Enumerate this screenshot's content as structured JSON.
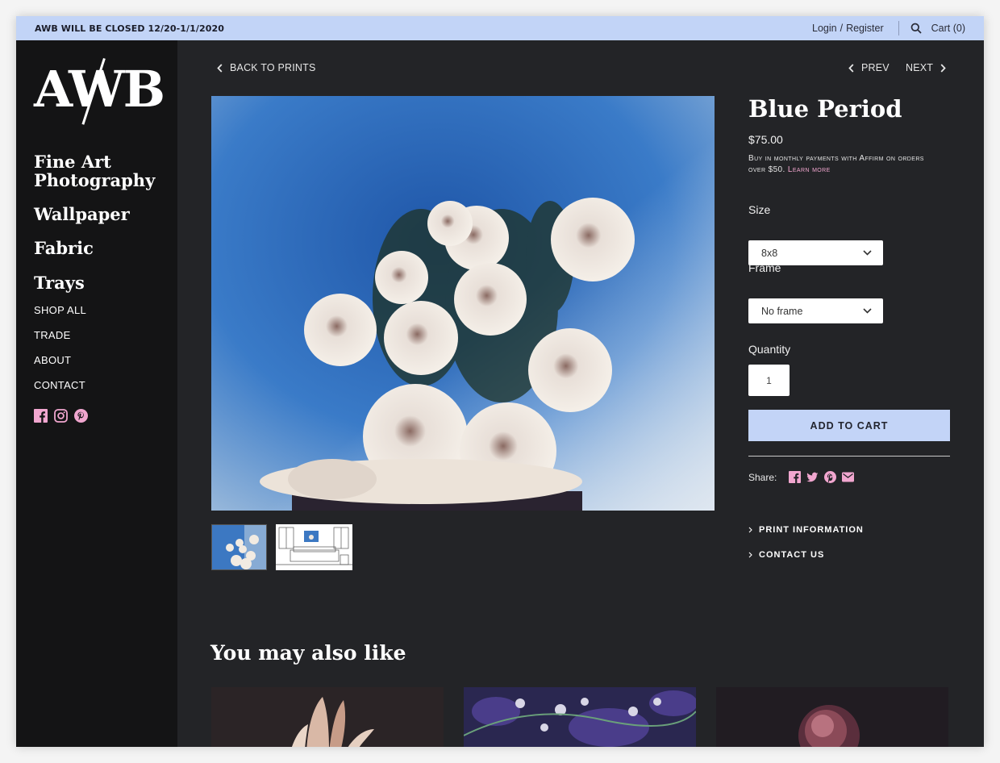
{
  "announcement": "AWB WILL BE CLOSED 12/20-1/1/2020",
  "topbar": {
    "login": "Login",
    "slash": "/",
    "register": "Register",
    "cart": "Cart (0)"
  },
  "logo": "AWB",
  "sidebar": {
    "big_items": [
      {
        "label": "Fine Art Photography"
      },
      {
        "label": "Wallpaper"
      },
      {
        "label": "Fabric"
      },
      {
        "label": "Trays"
      }
    ],
    "small_items": [
      {
        "label": "SHOP ALL"
      },
      {
        "label": "TRADE"
      },
      {
        "label": "ABOUT"
      },
      {
        "label": "CONTACT"
      }
    ],
    "socials": [
      "facebook-icon",
      "instagram-icon",
      "pinterest-icon"
    ]
  },
  "nav": {
    "back": "BACK TO PRINTS",
    "prev": "PREV",
    "next": "NEXT"
  },
  "product": {
    "title": "Blue Period",
    "price": "$75.00",
    "affirm_text": "Buy in monthly payments with Affirm on orders over $50.",
    "affirm_link": "Learn more",
    "size_label": "Size",
    "size_value": "8x8",
    "frame_label": "Frame",
    "frame_value": "No frame",
    "quantity_label": "Quantity",
    "quantity_value": "1",
    "add_to_cart": "ADD TO CART",
    "share_label": "Share:",
    "share_icons": [
      "facebook-icon",
      "twitter-icon",
      "pinterest-icon",
      "email-icon"
    ],
    "accordion": [
      "PRINT INFORMATION",
      "CONTACT US"
    ]
  },
  "related": {
    "heading": "You may also like"
  },
  "colors": {
    "accent_blue": "#c3d4f7",
    "accent_pink": "#f1a6cf",
    "background": "#232427",
    "sidebar": "#141415"
  }
}
